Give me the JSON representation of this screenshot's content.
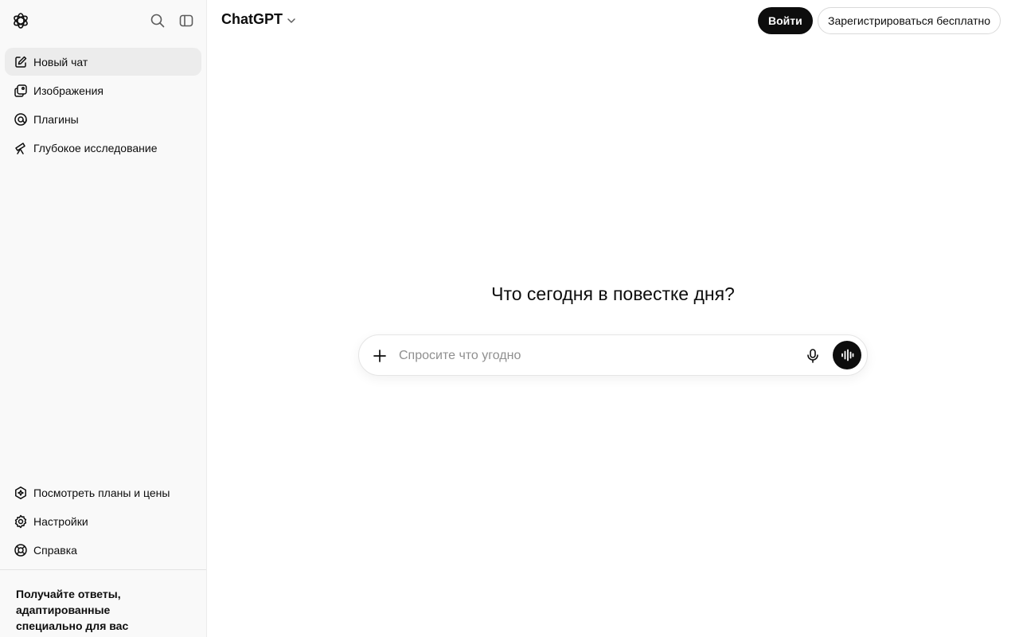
{
  "sidebar": {
    "logo_icon": "openai-logo-icon",
    "search_icon": "search-icon",
    "toggle_icon": "sidebar-toggle-icon",
    "items": [
      {
        "label": "Новый чат",
        "icon": "edit-icon",
        "active": true
      },
      {
        "label": "Изображения",
        "icon": "images-icon"
      },
      {
        "label": "Плагины",
        "icon": "plugins-icon"
      },
      {
        "label": "Глубокое исследование",
        "icon": "telescope-icon"
      }
    ],
    "bottom_items": [
      {
        "label": "Посмотреть планы и цены",
        "icon": "plans-icon"
      },
      {
        "label": "Настройки",
        "icon": "gear-icon"
      },
      {
        "label": "Справка",
        "icon": "help-icon"
      }
    ],
    "promo": "Получайте ответы, адаптированные специально для вас"
  },
  "header": {
    "model": "ChatGPT",
    "login": "Войти",
    "signup": "Зарегистрироваться бесплатно"
  },
  "main": {
    "headline": "Что сегодня в повестке дня?",
    "composer": {
      "placeholder": "Спросите что угодно",
      "value": ""
    }
  },
  "colors": {
    "accent": "#0d0d0d",
    "sidebar_bg": "#f9f9f9",
    "active_bg": "#ececec"
  }
}
